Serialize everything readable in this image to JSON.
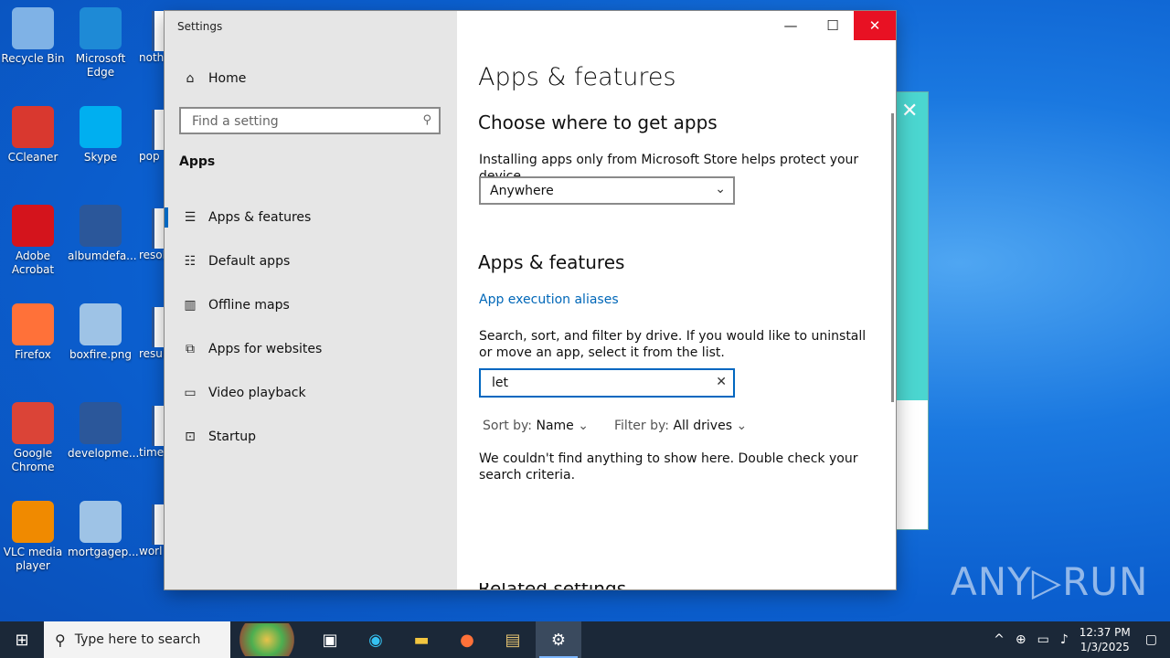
{
  "desktop": {
    "icons": [
      {
        "label": "Recycle Bin",
        "icon": "recycle-bin-icon",
        "color": "#7fb2e6"
      },
      {
        "label": "Microsoft Edge",
        "icon": "edge-icon",
        "color": "#1e8ad6"
      },
      {
        "label": "CCleaner",
        "icon": "ccleaner-icon",
        "color": "#d9382f"
      },
      {
        "label": "Skype",
        "icon": "skype-icon",
        "color": "#00aff0"
      },
      {
        "label": "Adobe Acrobat",
        "icon": "acrobat-icon",
        "color": "#d4141c"
      },
      {
        "label": "albumdefa...",
        "icon": "word-doc-icon",
        "color": "#2b579a"
      },
      {
        "label": "Firefox",
        "icon": "firefox-icon",
        "color": "#ff7139"
      },
      {
        "label": "boxfire.png",
        "icon": "image-file-icon",
        "color": "#9ec3e6"
      },
      {
        "label": "Google Chrome",
        "icon": "chrome-icon",
        "color": "#db4437"
      },
      {
        "label": "developme...",
        "icon": "word-doc-icon",
        "color": "#2b579a"
      },
      {
        "label": "VLC media player",
        "icon": "vlc-icon",
        "color": "#f08a00"
      },
      {
        "label": "mortgagep...",
        "icon": "image-file-icon",
        "color": "#9ec3e6"
      }
    ],
    "partial_labels": [
      "noth",
      "pop",
      "resol",
      "resul",
      "time",
      "worl"
    ]
  },
  "settings": {
    "window_title": "Settings",
    "sidebar": {
      "home": "Home",
      "search_placeholder": "Find a setting",
      "section": "Apps",
      "items": [
        {
          "label": "Apps & features",
          "icon": "list-icon"
        },
        {
          "label": "Default apps",
          "icon": "default-apps-icon"
        },
        {
          "label": "Offline maps",
          "icon": "map-icon"
        },
        {
          "label": "Apps for websites",
          "icon": "open-web-icon"
        },
        {
          "label": "Video playback",
          "icon": "video-icon"
        },
        {
          "label": "Startup",
          "icon": "startup-icon"
        }
      ]
    },
    "main": {
      "page_title": "Apps & features",
      "choose_heading": "Choose where to get apps",
      "choose_desc": "Installing apps only from Microsoft Store helps protect your device.",
      "source_selected": "Anywhere",
      "apps_heading": "Apps & features",
      "aliases_link": "App execution aliases",
      "search_desc": "Search, sort, and filter by drive. If you would like to uninstall or move an app, select it from the list.",
      "search_value": "let",
      "sort_label": "Sort by:",
      "sort_value": "Name",
      "filter_label": "Filter by:",
      "filter_value": "All drives",
      "empty_message": "We couldn't find anything to show here. Double check your search criteria.",
      "cutoff_heading": "Related settings"
    }
  },
  "taskbar": {
    "search_placeholder": "Type here to search",
    "time": "12:37 PM",
    "date": "1/3/2025"
  },
  "watermark": "ANY▷RUN",
  "colors": {
    "accent": "#0067c0",
    "link": "#0067b8",
    "close": "#e81123"
  }
}
